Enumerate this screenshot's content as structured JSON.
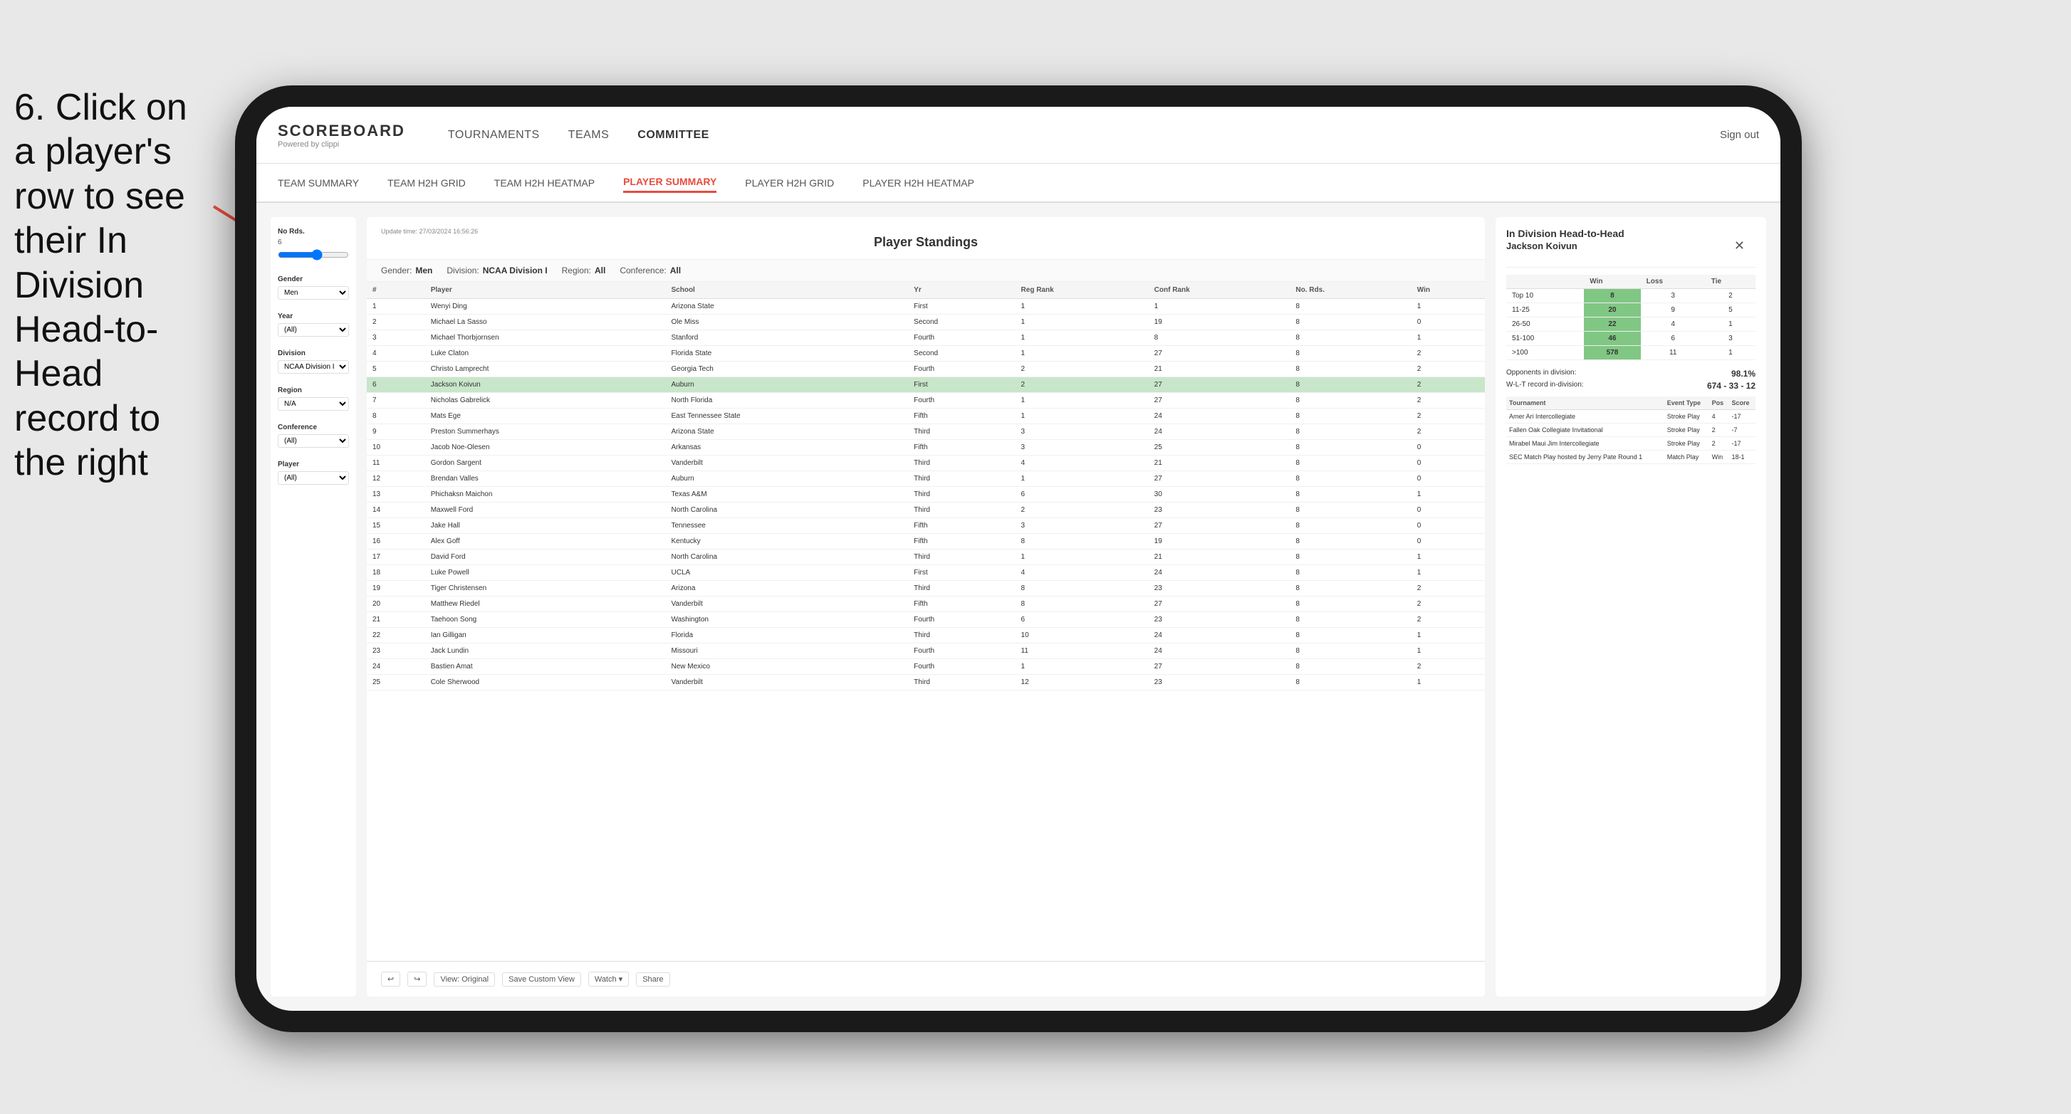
{
  "instruction": {
    "text": "6. Click on a player's row to see their In Division Head-to-Head record to the right"
  },
  "nav": {
    "logo": "SCOREBOARD",
    "logo_sub": "Powered by clippi",
    "links": [
      "TOURNAMENTS",
      "TEAMS",
      "COMMITTEE"
    ],
    "sign_out": "Sign out"
  },
  "sub_nav": {
    "links": [
      "TEAM SUMMARY",
      "TEAM H2H GRID",
      "TEAM H2H HEATMAP",
      "PLAYER SUMMARY",
      "PLAYER H2H GRID",
      "PLAYER H2H HEATMAP"
    ],
    "active": "PLAYER SUMMARY"
  },
  "sidebar": {
    "no_rds_label": "No Rds.",
    "no_rds_value": "6",
    "gender_label": "Gender",
    "gender_value": "Men",
    "year_label": "Year",
    "year_value": "(All)",
    "division_label": "Division",
    "division_value": "NCAA Division I",
    "region_label": "Region",
    "region_value": "N/A",
    "conference_label": "Conference",
    "conference_value": "(All)",
    "player_label": "Player",
    "player_value": "(All)"
  },
  "center": {
    "title": "Player Standings",
    "update_time": "Update time: 27/03/2024 16:56:26",
    "filters": {
      "gender": "Men",
      "division": "NCAA Division I",
      "region": "All",
      "conference": "All"
    },
    "table_headers": [
      "#",
      "Player",
      "School",
      "Yr",
      "Reg Rank",
      "Conf Rank",
      "No. Rds.",
      "Win"
    ],
    "rows": [
      {
        "rank": 1,
        "player": "Wenyi Ding",
        "school": "Arizona State",
        "year": "First",
        "reg_rank": 1,
        "conf_rank": 1,
        "no_rds": 8,
        "win": 1
      },
      {
        "rank": 2,
        "player": "Michael La Sasso",
        "school": "Ole Miss",
        "year": "Second",
        "reg_rank": 1,
        "conf_rank": 19,
        "no_rds": 8,
        "win": 0
      },
      {
        "rank": 3,
        "player": "Michael Thorbjornsen",
        "school": "Stanford",
        "year": "Fourth",
        "reg_rank": 1,
        "conf_rank": 8,
        "no_rds": 8,
        "win": 1
      },
      {
        "rank": 4,
        "player": "Luke Claton",
        "school": "Florida State",
        "year": "Second",
        "reg_rank": 1,
        "conf_rank": 27,
        "no_rds": 8,
        "win": 2
      },
      {
        "rank": 5,
        "player": "Christo Lamprecht",
        "school": "Georgia Tech",
        "year": "Fourth",
        "reg_rank": 2,
        "conf_rank": 21,
        "no_rds": 8,
        "win": 2
      },
      {
        "rank": 6,
        "player": "Jackson Koivun",
        "school": "Auburn",
        "year": "First",
        "reg_rank": 2,
        "conf_rank": 27,
        "no_rds": 8,
        "win": 2,
        "selected": true
      },
      {
        "rank": 7,
        "player": "Nicholas Gabrelick",
        "school": "North Florida",
        "year": "Fourth",
        "reg_rank": 1,
        "conf_rank": 27,
        "no_rds": 8,
        "win": 2
      },
      {
        "rank": 8,
        "player": "Mats Ege",
        "school": "East Tennessee State",
        "year": "Fifth",
        "reg_rank": 1,
        "conf_rank": 24,
        "no_rds": 8,
        "win": 2
      },
      {
        "rank": 9,
        "player": "Preston Summerhays",
        "school": "Arizona State",
        "year": "Third",
        "reg_rank": 3,
        "conf_rank": 24,
        "no_rds": 8,
        "win": 2
      },
      {
        "rank": 10,
        "player": "Jacob Noe-Olesen",
        "school": "Arkansas",
        "year": "Fifth",
        "reg_rank": 3,
        "conf_rank": 25,
        "no_rds": 8,
        "win": 0
      },
      {
        "rank": 11,
        "player": "Gordon Sargent",
        "school": "Vanderbilt",
        "year": "Third",
        "reg_rank": 4,
        "conf_rank": 21,
        "no_rds": 8,
        "win": 0
      },
      {
        "rank": 12,
        "player": "Brendan Valles",
        "school": "Auburn",
        "year": "Third",
        "reg_rank": 1,
        "conf_rank": 27,
        "no_rds": 8,
        "win": 0
      },
      {
        "rank": 13,
        "player": "Phichaksn Maichon",
        "school": "Texas A&M",
        "year": "Third",
        "reg_rank": 6,
        "conf_rank": 30,
        "no_rds": 8,
        "win": 1
      },
      {
        "rank": 14,
        "player": "Maxwell Ford",
        "school": "North Carolina",
        "year": "Third",
        "reg_rank": 2,
        "conf_rank": 23,
        "no_rds": 8,
        "win": 0
      },
      {
        "rank": 15,
        "player": "Jake Hall",
        "school": "Tennessee",
        "year": "Fifth",
        "reg_rank": 3,
        "conf_rank": 27,
        "no_rds": 8,
        "win": 0
      },
      {
        "rank": 16,
        "player": "Alex Goff",
        "school": "Kentucky",
        "year": "Fifth",
        "reg_rank": 8,
        "conf_rank": 19,
        "no_rds": 8,
        "win": 0
      },
      {
        "rank": 17,
        "player": "David Ford",
        "school": "North Carolina",
        "year": "Third",
        "reg_rank": 1,
        "conf_rank": 21,
        "no_rds": 8,
        "win": 1
      },
      {
        "rank": 18,
        "player": "Luke Powell",
        "school": "UCLA",
        "year": "First",
        "reg_rank": 4,
        "conf_rank": 24,
        "no_rds": 8,
        "win": 1
      },
      {
        "rank": 19,
        "player": "Tiger Christensen",
        "school": "Arizona",
        "year": "Third",
        "reg_rank": 8,
        "conf_rank": 23,
        "no_rds": 8,
        "win": 2
      },
      {
        "rank": 20,
        "player": "Matthew Riedel",
        "school": "Vanderbilt",
        "year": "Fifth",
        "reg_rank": 8,
        "conf_rank": 27,
        "no_rds": 8,
        "win": 2
      },
      {
        "rank": 21,
        "player": "Taehoon Song",
        "school": "Washington",
        "year": "Fourth",
        "reg_rank": 6,
        "conf_rank": 23,
        "no_rds": 8,
        "win": 2
      },
      {
        "rank": 22,
        "player": "Ian Gilligan",
        "school": "Florida",
        "year": "Third",
        "reg_rank": 10,
        "conf_rank": 24,
        "no_rds": 8,
        "win": 1
      },
      {
        "rank": 23,
        "player": "Jack Lundin",
        "school": "Missouri",
        "year": "Fourth",
        "reg_rank": 11,
        "conf_rank": 24,
        "no_rds": 8,
        "win": 1
      },
      {
        "rank": 24,
        "player": "Bastien Amat",
        "school": "New Mexico",
        "year": "Fourth",
        "reg_rank": 1,
        "conf_rank": 27,
        "no_rds": 8,
        "win": 2
      },
      {
        "rank": 25,
        "player": "Cole Sherwood",
        "school": "Vanderbilt",
        "year": "Third",
        "reg_rank": 12,
        "conf_rank": 23,
        "no_rds": 8,
        "win": 1
      }
    ]
  },
  "toolbar": {
    "view_original": "View: Original",
    "save_custom": "Save Custom View",
    "watch": "Watch ▾",
    "share": "Share"
  },
  "right_panel": {
    "title": "In Division Head-to-Head",
    "player": "Jackson Koivun",
    "close_icon": "✕",
    "h2h_headers": [
      "",
      "Win",
      "Loss",
      "Tie"
    ],
    "h2h_rows": [
      {
        "label": "Top 10",
        "win": 8,
        "loss": 3,
        "tie": 2
      },
      {
        "label": "11-25",
        "win": 20,
        "loss": 9,
        "tie": 5
      },
      {
        "label": "26-50",
        "win": 22,
        "loss": 4,
        "tie": 1
      },
      {
        "label": "51-100",
        "win": 46,
        "loss": 6,
        "tie": 3
      },
      {
        "label": ">100",
        "win": 578,
        "loss": 11,
        "tie": 1
      }
    ],
    "opponents_label": "Opponents in division:",
    "wlt_label": "W-L-T record in-division:",
    "opponents_pct": "98.1%",
    "wlt_record": "674 - 33 - 12",
    "tournament_headers": [
      "Tournament",
      "Event Type",
      "Pos",
      "Score"
    ],
    "tournaments": [
      {
        "name": "Amer Ari Intercollegiate",
        "type": "Stroke Play",
        "pos": 4,
        "score": "-17"
      },
      {
        "name": "Fallen Oak Collegiate Invitational",
        "type": "Stroke Play",
        "pos": 2,
        "score": "-7"
      },
      {
        "name": "Mirabel Maui Jim Intercollegiate",
        "type": "Stroke Play",
        "pos": 2,
        "score": "-17"
      },
      {
        "name": "SEC Match Play hosted by Jerry Pate Round 1",
        "type": "Match Play",
        "pos": "Win",
        "score": "18-1"
      }
    ]
  }
}
